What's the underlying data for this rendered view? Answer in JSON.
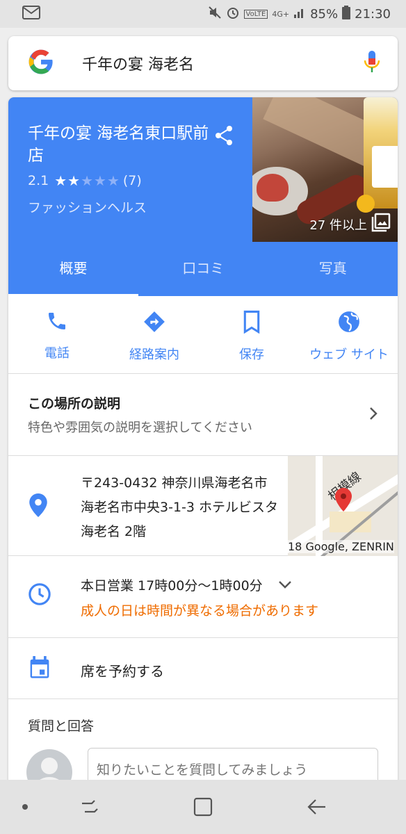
{
  "status_bar": {
    "battery": "85%",
    "time": "21:30",
    "network": "4G+",
    "volte": "VoLTE"
  },
  "search": {
    "query": "千年の宴 海老名"
  },
  "place": {
    "name": "千年の宴 海老名東口駅前店",
    "rating": "2.1",
    "stars_filled": 2,
    "stars_total": 5,
    "review_count": "(7)",
    "category": "ファッションヘルス",
    "photo_count": "27 件以上"
  },
  "tabs": [
    {
      "label": "概要",
      "active": true
    },
    {
      "label": "口コミ",
      "active": false
    },
    {
      "label": "写真",
      "active": false
    }
  ],
  "actions": [
    {
      "label": "電話",
      "icon": "phone-icon"
    },
    {
      "label": "経路案内",
      "icon": "directions-icon"
    },
    {
      "label": "保存",
      "icon": "bookmark-icon"
    },
    {
      "label": "ウェブ サイト",
      "icon": "globe-icon"
    }
  ],
  "description": {
    "heading": "この場所の説明",
    "subtext": "特色や雰囲気の説明を選択してください"
  },
  "address": {
    "text": "〒243-0432 神奈川県海老名市 海老名市中央3-1-3 ホテルビスタ海老名 2階",
    "map_label": "相模線",
    "map_attribution": "18 Google, ZENRIN"
  },
  "hours": {
    "today": "本日営業 17時00分～1時00分",
    "notice": "成人の日は時間が異なる場合があります"
  },
  "reserve": {
    "label": "席を予約する"
  },
  "qa": {
    "title": "質問と回答",
    "placeholder": "知りたいことを質問してみましょう"
  },
  "colors": {
    "accent": "#4285f4",
    "warning": "#ef6c00",
    "map_pin": "#e53935"
  }
}
